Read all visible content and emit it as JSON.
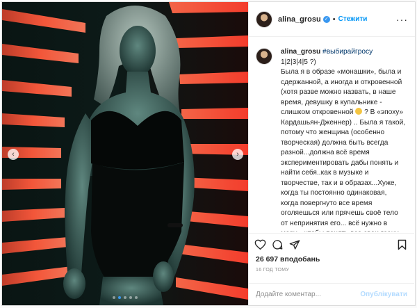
{
  "post": {
    "username": "alina_grosu",
    "follow_label": "Стежити",
    "separator": "•",
    "more_label": "···"
  },
  "caption": {
    "username": "alina_grosu",
    "hashtag": "#выбирайгросу",
    "text_before_emoji": "1|2|3|4|5 ?)\nБыла я в образе «монашки», была и сдержанной, а иногда и откровенной (хотя разве можно назвать, в наше время, девушку в купальнике - слишком откровенной",
    "text_after_emoji": "? В «эпоху» Кардашьян-Дженнер) .. Была я такой, потому что женщина (особенно творческая) должна быть всегда разной...должна всё время экспериментировать дабы понять и найти себя..как в музыке и творчестве, так и в образах...Хуже, когда ты постоянно одинаковая, когда повергнуто все время оголяешься или прячешь своё тело от непринятия его... всё нужно в меру... чтобы понять все свои грани, возможности и лучшие стороны.."
  },
  "likes": {
    "text": "26 697 вподобань"
  },
  "timestamp": "16 ГОД ТОМУ",
  "comment_box": {
    "placeholder": "Додайте коментар...",
    "post_label": "Опублікувати"
  },
  "carousel": {
    "prev_label": "‹",
    "next_label": "›",
    "slide_count": 5,
    "active_slide": 1
  },
  "colors": {
    "accent": "#0095f6",
    "verified": "#3897f0",
    "post_button_disabled": "#b3dbff",
    "border": "#dbdbdb"
  },
  "icons": {
    "like": "heart-icon",
    "comment": "comment-icon",
    "share": "share-icon",
    "save": "bookmark-icon",
    "verified": "verified-badge-icon",
    "more": "more-options-icon"
  }
}
